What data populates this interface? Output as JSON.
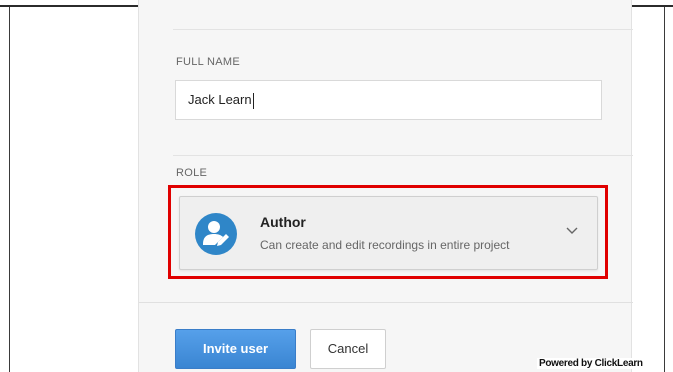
{
  "form": {
    "full_name_label": "FULL NAME",
    "full_name_value": "Jack Learn",
    "role_label": "ROLE",
    "role": {
      "selected_title": "Author",
      "selected_description": "Can create and edit recordings in entire project",
      "icon": "user-edit-icon"
    }
  },
  "actions": {
    "invite_label": "Invite user",
    "cancel_label": "Cancel"
  },
  "watermark": "Powered by ClickLearn",
  "colors": {
    "accent": "#4a90e2",
    "highlight": "#e00000",
    "avatar": "#2f86c8"
  }
}
